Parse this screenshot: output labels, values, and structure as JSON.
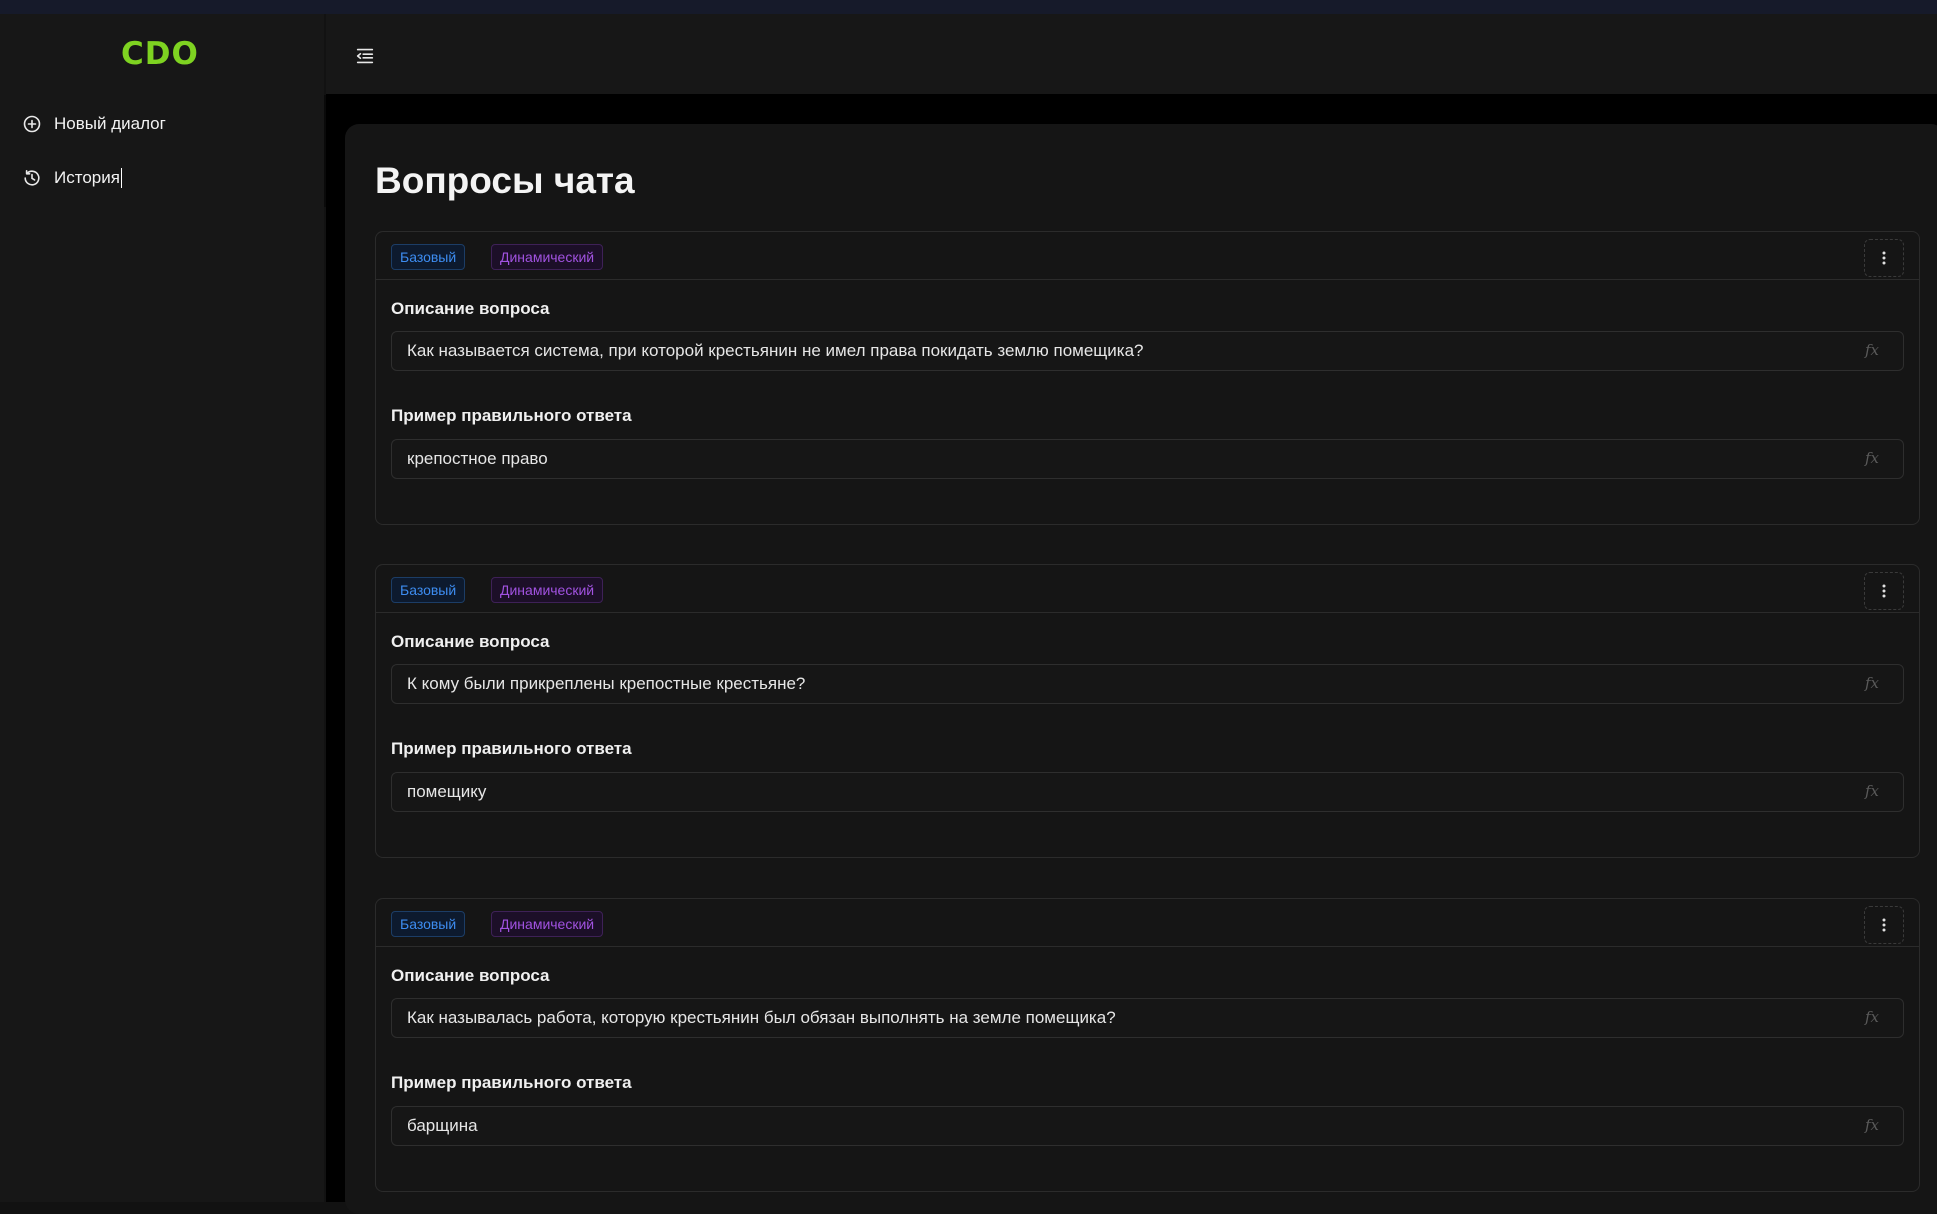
{
  "app": {
    "logo": "CDO",
    "brand_color": "#7ed321"
  },
  "sidebar": {
    "items": [
      {
        "label": "Новый диалог",
        "icon": "plus-circle-icon"
      },
      {
        "label": "История",
        "icon": "history-icon"
      }
    ]
  },
  "header": {
    "menu_icon": "menu-collapse-icon"
  },
  "main": {
    "title": "Вопросы чата",
    "questions": [
      {
        "tags": [
          "Базовый",
          "Динамический"
        ],
        "description_label": "Описание вопроса",
        "description": "Как называется система, при которой крестьянин не имел права покидать землю помещика?",
        "answer_label": "Пример правильного ответа",
        "answer": "крепостное право"
      },
      {
        "tags": [
          "Базовый",
          "Динамический"
        ],
        "description_label": "Описание вопроса",
        "description": "К кому были прикреплены крепостные крестьяне?",
        "answer_label": "Пример правильного ответа",
        "answer": "помещику"
      },
      {
        "tags": [
          "Базовый",
          "Динамический"
        ],
        "description_label": "Описание вопроса",
        "description": "Как называлась работа, которую крестьянин был обязан выполнять на земле помещика?",
        "answer_label": "Пример правильного ответа",
        "answer": "барщина"
      }
    ],
    "field_suffix": "fx",
    "tag_colors": {
      "base": "#3d8cf0",
      "dynamic": "#a152e0"
    }
  }
}
